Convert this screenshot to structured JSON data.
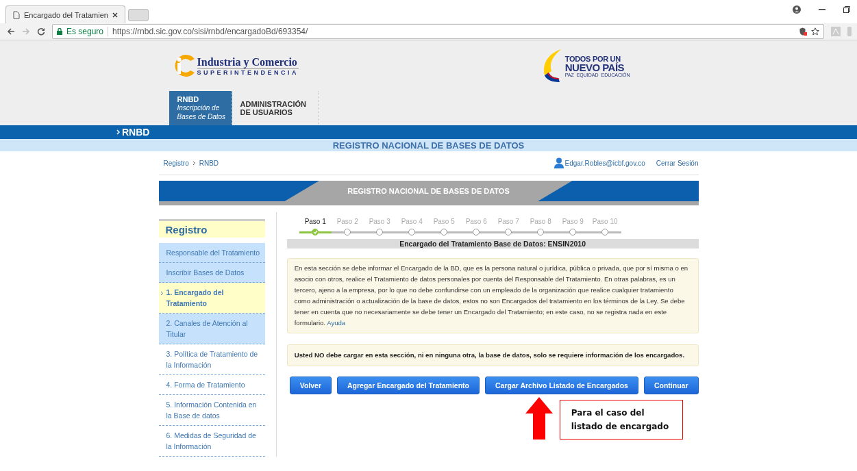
{
  "browser": {
    "tab_title": "Encargado del Tratamien",
    "secure_label": "Es seguro",
    "url": "https://rnbd.sic.gov.co/sisi/rnbd/encargadoBd/693354/"
  },
  "header": {
    "logo_left": {
      "name": "Industria y Comercio",
      "subtitle": "SUPERINTENDENCIA"
    },
    "logo_right": {
      "line1": "TODOS POR UN",
      "line2": "NUEVO PAÍS",
      "tagline": "PAZ  EQUIDAD  EDUCACIÓN"
    },
    "nav": [
      {
        "title": "RNBD",
        "subtitle": "Inscripción de Bases de Datos",
        "selected": true
      },
      {
        "title": "ADMINISTRACIÓN DE USUARIOS",
        "selected": false
      }
    ]
  },
  "section_bar": {
    "label": "RNBD"
  },
  "page_title": "REGISTRO NACIONAL DE BASES DE DATOS",
  "breadcrumb": [
    "Registro",
    "RNBD"
  ],
  "user": {
    "email": "Edgar.Robles@icbf.gov.co",
    "logout": "Cerrar Sesión"
  },
  "banner_title": "REGISTRO NACIONAL DE BASES DE DATOS",
  "sidebar": {
    "title": "Registro",
    "items": [
      {
        "label": "Responsable del Tratamiento",
        "highlighted": true,
        "selected": false
      },
      {
        "label": "Inscribir Bases de Datos",
        "highlighted": true,
        "selected": false
      },
      {
        "label": "1. Encargado del Tratamiento",
        "highlighted": false,
        "selected": true
      },
      {
        "label": "2. Canales de Atención al Titular",
        "highlighted": true,
        "selected": false
      },
      {
        "label": "3. Política de Tratamiento de la Información",
        "highlighted": false,
        "selected": false
      },
      {
        "label": "4. Forma de Tratamiento",
        "highlighted": false,
        "selected": false
      },
      {
        "label": "5. Información Contenida en la Base de datos",
        "highlighted": false,
        "selected": false
      },
      {
        "label": "6. Medidas de Seguridad de la Información",
        "highlighted": false,
        "selected": false
      }
    ]
  },
  "steps": [
    {
      "label": "Paso 1",
      "selected": true,
      "done": true
    },
    {
      "label": "Paso 2",
      "selected": false,
      "done": false
    },
    {
      "label": "Paso 3",
      "selected": false,
      "done": false
    },
    {
      "label": "Paso 4",
      "selected": false,
      "done": false
    },
    {
      "label": "Paso 5",
      "selected": false,
      "done": false
    },
    {
      "label": "Paso 6",
      "selected": false,
      "done": false
    },
    {
      "label": "Paso 7",
      "selected": false,
      "done": false
    },
    {
      "label": "Paso 8",
      "selected": false,
      "done": false
    },
    {
      "label": "Paso 9",
      "selected": false,
      "done": false
    },
    {
      "label": "Paso 10",
      "selected": false,
      "done": false
    }
  ],
  "form_title": "Encargado del Tratamiento Base de Datos: ENSIN2010",
  "info": {
    "text": "En esta sección se debe informar el Encargado de la BD, que es la persona natural o jurídica, pública o privada, que por sí misma o en asocio con otros, realice el Tratamiento de datos personales por cuenta del Responsable del Tratamiento. En otras palabras, es un tercero, ajeno a la empresa, por lo que no debe confundirse con un empleado de la organización que realice cualquier tratamiento como administración o actualización de la base de datos, estos no son Encargados del tratamiento en los términos de la Ley. Se debe tener en cuenta que no necesariamente se debe tener un Encargado del Tratamiento; en este caso, no se registra nada en este formulario.",
    "link": "Ayuda"
  },
  "warning": "Usted NO debe cargar en esta sección, ni en ninguna otra, la base de datos, solo se requiere información de los encargados.",
  "buttons": [
    "Volver",
    "Agregar Encargado del Tratamiento",
    "Cargar Archivo Listado de Encargados",
    "Continuar"
  ],
  "annotation": "Para el caso del listado de encargado"
}
